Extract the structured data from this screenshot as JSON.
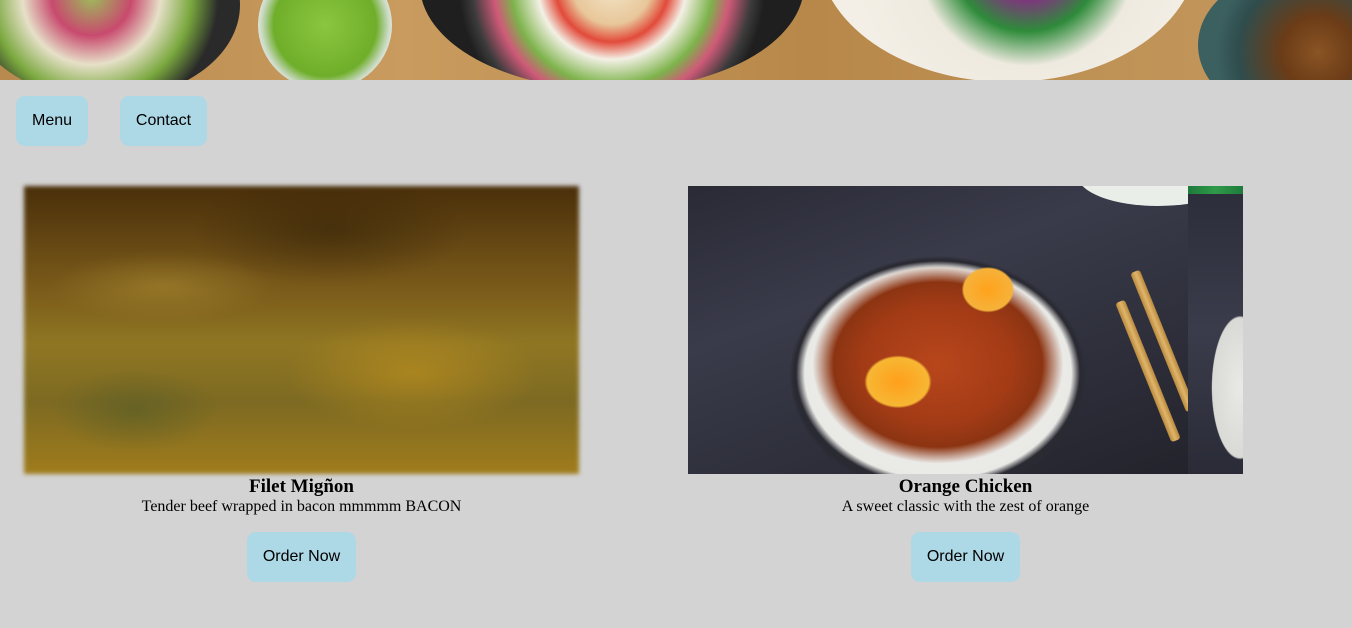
{
  "header": {
    "banner_image": "food-spread-banner-image"
  },
  "nav": {
    "menu_label": "Menu",
    "contact_label": "Contact"
  },
  "products": [
    {
      "image": "filet-mignon-photo",
      "title": "Filet Migñon",
      "description": "Tender beef wrapped in bacon mmmmm BACON",
      "button_label": "Order Now"
    },
    {
      "image": "orange-chicken-photo",
      "title": "Orange Chicken",
      "description": "A sweet classic with the zest of orange",
      "button_label": "Order Now"
    }
  ],
  "colors": {
    "page_background": "#d3d3d3",
    "button_background": "#add8e6",
    "text": "#000000"
  }
}
